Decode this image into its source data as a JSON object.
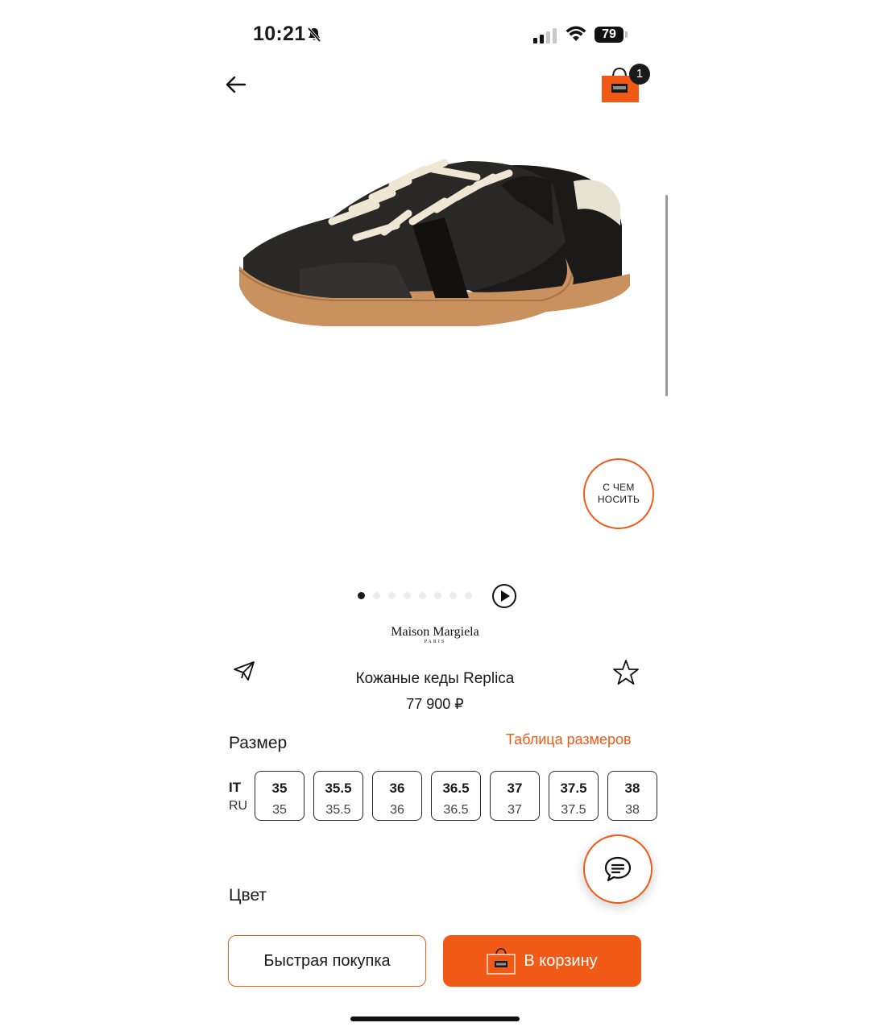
{
  "status_bar": {
    "time": "10:21",
    "battery": "79"
  },
  "header": {
    "cart_count": "1"
  },
  "gallery": {
    "wear_with_line1": "С ЧЕМ",
    "wear_with_line2": "НОСИТЬ",
    "dots_total": 8,
    "active_dot": 0
  },
  "product": {
    "brand": "Maison Margiela",
    "brand_sub": "PARIS",
    "name": "Кожаные кеды Replica",
    "price": "77 900 ₽"
  },
  "size_section": {
    "label": "Размер",
    "table_link": "Таблица размеров",
    "system_it": "IT",
    "system_ru": "RU",
    "sizes": [
      {
        "it": "35",
        "ru": "35"
      },
      {
        "it": "35.5",
        "ru": "35.5"
      },
      {
        "it": "36",
        "ru": "36"
      },
      {
        "it": "36.5",
        "ru": "36.5"
      },
      {
        "it": "37",
        "ru": "37"
      },
      {
        "it": "37.5",
        "ru": "37.5"
      },
      {
        "it": "38",
        "ru": "38"
      }
    ]
  },
  "color_section": {
    "label": "Цвет"
  },
  "actions": {
    "quick_buy": "Быстрая покупка",
    "add_to_cart": "В корзину"
  },
  "colors": {
    "accent": "#f05a16",
    "text": "#1a1a1a"
  }
}
